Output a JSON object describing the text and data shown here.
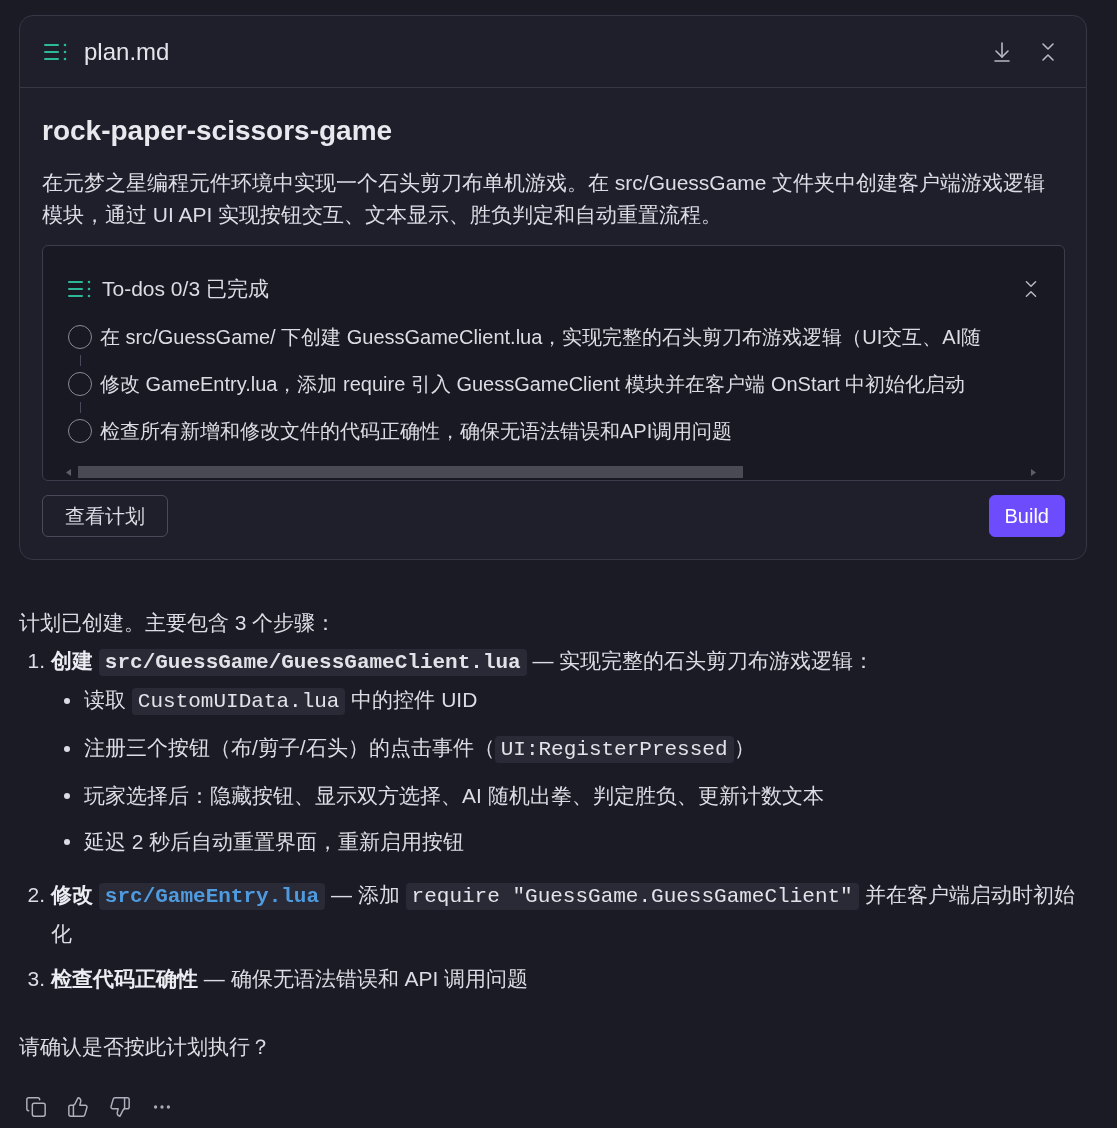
{
  "plan_card": {
    "filename": "plan.md",
    "title": "rock-paper-scissors-game",
    "description": "在元梦之星编程元件环境中实现一个石头剪刀布单机游戏。在 src/GuessGame 文件夹中创建客户端游戏逻辑模块，通过 UI API 实现按钮交互、文本显示、胜负判定和自动重置流程。",
    "todos": {
      "header": "To-dos 0/3 已完成",
      "items": [
        {
          "text": "在 src/GuessGame/ 下创建 GuessGameClient.lua，实现完整的石头剪刀布游戏逻辑（UI交互、AI随",
          "checked": false
        },
        {
          "text": "修改 GameEntry.lua，添加 require 引入 GuessGameClient 模块并在客户端 OnStart 中初始化启动",
          "checked": false
        },
        {
          "text": "检查所有新增和修改文件的代码正确性，确保无语法错误和API调用问题",
          "checked": false
        }
      ]
    },
    "buttons": [
      {
        "label": "查看计划",
        "kind": "secondary"
      },
      {
        "label": "Build",
        "kind": "primary"
      }
    ]
  },
  "message": {
    "intro": "计划已创建。主要包含 3 个步骤：",
    "steps": [
      {
        "number": "1.",
        "parts": [
          {
            "kind": "bold",
            "text": "创建 "
          },
          {
            "kind": "bold_code",
            "text": "src/GuessGame/GuessGameClient.lua"
          },
          {
            "kind": "text",
            "text": " — 实现完整的石头剪刀布游戏逻辑："
          }
        ],
        "bullets": [
          {
            "parts": [
              {
                "kind": "text",
                "text": "读取 "
              },
              {
                "kind": "code",
                "text": "CustomUIData.lua"
              },
              {
                "kind": "text",
                "text": " 中的控件 UID"
              }
            ]
          },
          {
            "parts": [
              {
                "kind": "text",
                "text": "注册三个按钮（布/剪子/石头）的点击事件（"
              },
              {
                "kind": "code",
                "text": "UI:RegisterPressed"
              },
              {
                "kind": "text",
                "text": "）"
              }
            ]
          },
          {
            "parts": [
              {
                "kind": "text",
                "text": "玩家选择后：隐藏按钮、显示双方选择、AI 随机出拳、判定胜负、更新计数文本"
              }
            ]
          },
          {
            "parts": [
              {
                "kind": "text",
                "text": "延迟 2 秒后自动重置界面，重新启用按钮"
              }
            ]
          }
        ]
      },
      {
        "number": "2.",
        "parts": [
          {
            "kind": "bold",
            "text": "修改 "
          },
          {
            "kind": "link",
            "text": "src/GameEntry.lua"
          },
          {
            "kind": "text",
            "text": " — 添加 "
          },
          {
            "kind": "code",
            "text": "require \"GuessGame.GuessGameClient\""
          },
          {
            "kind": "text",
            "text": " 并在客户端启动时初始化"
          }
        ]
      },
      {
        "number": "3.",
        "parts": [
          {
            "kind": "bold",
            "text": "检查代码正确性"
          },
          {
            "kind": "text",
            "text": " — 确保无语法错误和 API 调用问题"
          }
        ]
      }
    ],
    "question": "请确认是否按此计划执行？"
  }
}
